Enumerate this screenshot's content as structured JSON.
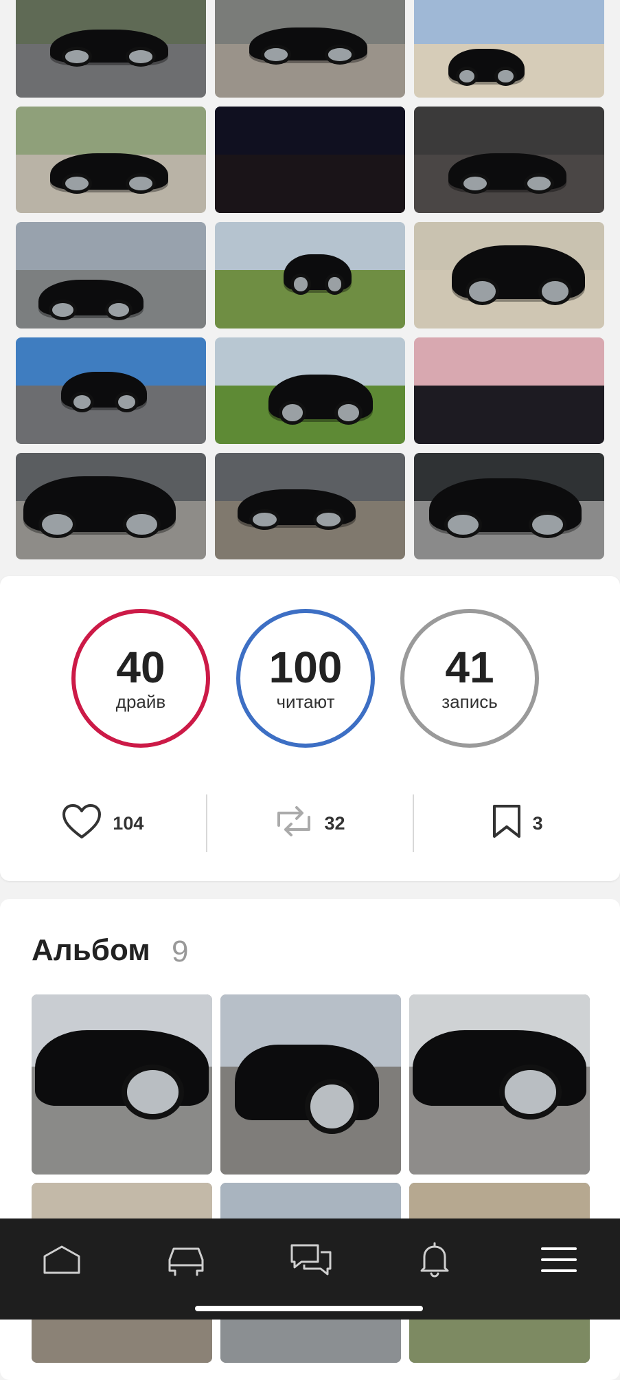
{
  "photo_grid": {
    "count": 15
  },
  "stats": {
    "drive": {
      "value": "40",
      "label": "драйв",
      "color": "#cc1a47"
    },
    "readers": {
      "value": "100",
      "label": "читают",
      "color": "#3d6fc4"
    },
    "posts": {
      "value": "41",
      "label": "запись",
      "color": "#9a9a9a"
    }
  },
  "actions": {
    "likes": "104",
    "reposts": "32",
    "bookmarks": "3"
  },
  "album": {
    "title": "Альбом",
    "count": "9"
  },
  "bottom_nav": {
    "items": [
      "home-icon",
      "car-icon",
      "chat-icon",
      "bell-icon",
      "menu-icon"
    ]
  },
  "colors": {
    "nav_background": "#1e1e1e",
    "card_background": "#ffffff",
    "page_background": "#f2f2f2"
  }
}
